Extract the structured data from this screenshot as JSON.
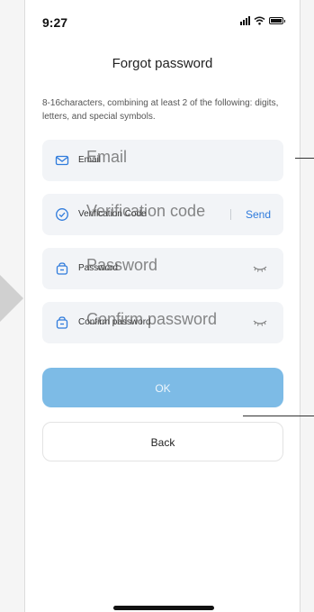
{
  "status": {
    "time": "9:27"
  },
  "page": {
    "title": "Forgot password",
    "hint": "8-16characters, combining at least 2 of the following: digits, letters, and special symbols."
  },
  "fields": {
    "email": {
      "label": "Email",
      "placeholder": "Email",
      "icon": "mail-icon"
    },
    "verification": {
      "label": "Verification Code",
      "placeholder": "Verification code",
      "icon": "shield-check-icon",
      "send": "Send"
    },
    "password": {
      "label": "Password",
      "placeholder": "Password",
      "icon": "lock-icon"
    },
    "confirm": {
      "label": "Confirm password",
      "placeholder": "Confirm password",
      "icon": "lock-icon"
    }
  },
  "buttons": {
    "ok": "OK",
    "back": "Back"
  },
  "colors": {
    "accent": "#2f7bdc",
    "ok_button": "#7dbbe6",
    "field_bg": "#f2f4f7"
  }
}
